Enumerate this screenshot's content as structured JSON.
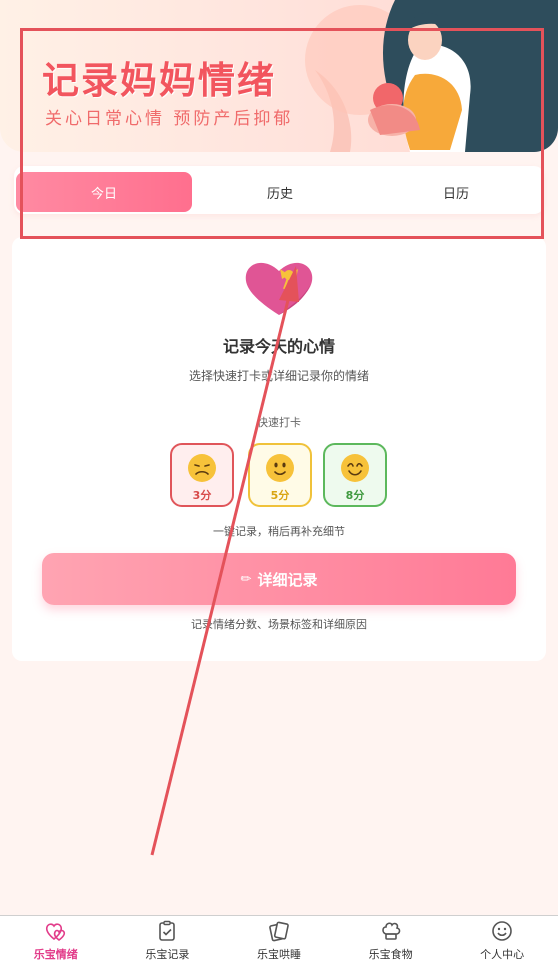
{
  "banner": {
    "title": "记录妈妈情绪",
    "subtitle": "关心日常心情 预防产后抑郁"
  },
  "tabs": [
    {
      "label": "今日",
      "active": true
    },
    {
      "label": "历史",
      "active": false
    },
    {
      "label": "日历",
      "active": false
    }
  ],
  "card": {
    "icon": "heart-gift-icon",
    "title": "记录今天的心情",
    "description": "选择快速打卡或详细记录你的情绪",
    "quick_label": "快速打卡",
    "moods": [
      {
        "icon": "sad-face-icon",
        "score": "3分",
        "color": "#e0555a"
      },
      {
        "icon": "neutral-smile-icon",
        "score": "5分",
        "color": "#f0c23a"
      },
      {
        "icon": "happy-face-icon",
        "score": "8分",
        "color": "#5cb85c"
      }
    ],
    "quick_hint": "一键记录，稍后再补充细节",
    "detail_button": "详细记录",
    "detail_hint": "记录情绪分数、场景标签和详细原因"
  },
  "nav": [
    {
      "label": "乐宝情绪",
      "icon": "hearts-icon",
      "active": true
    },
    {
      "label": "乐宝记录",
      "icon": "clipboard-icon",
      "active": false
    },
    {
      "label": "乐宝哄睡",
      "icon": "cards-icon",
      "active": false
    },
    {
      "label": "乐宝食物",
      "icon": "chef-hat-icon",
      "active": false
    },
    {
      "label": "个人中心",
      "icon": "smiley-icon",
      "active": false
    }
  ],
  "colors": {
    "accent": "#ff7a96",
    "title_red": "#f2555e",
    "nav_active": "#e23c8a",
    "annotation": "#e4525a"
  }
}
